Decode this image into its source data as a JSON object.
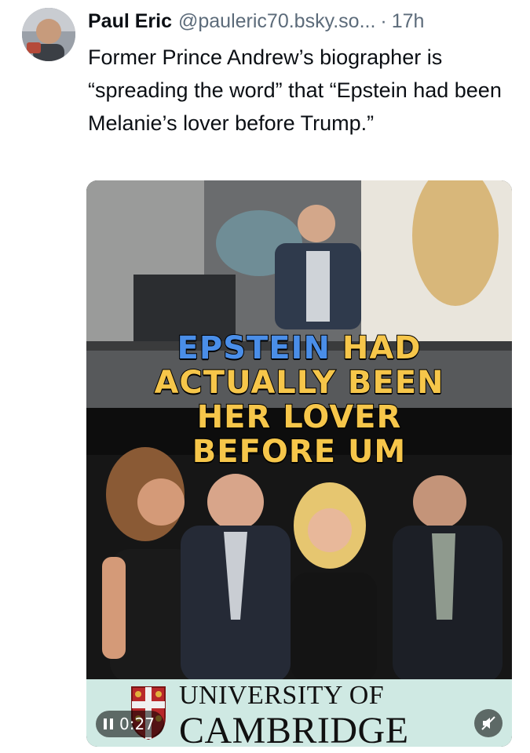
{
  "post": {
    "author_name": "Paul Eric",
    "handle": "@pauleric70.bsky.so...",
    "separator": "·",
    "time": "17h",
    "text": "Former Prince Andrew’s biographer is “spreading the word” that “Epstein had been Melanie’s lover before Trump.”"
  },
  "video": {
    "caption_word_1": "EPSTEIN",
    "caption_word_2": "HAD",
    "caption_line_2": "ACTUALLY BEEN",
    "caption_line_3": "HER LOVER",
    "caption_line_4": "BEFORE UM",
    "banner_line_1": "UNIVERSITY OF",
    "banner_line_2": "CAMBRIDGE",
    "elapsed": "0:27",
    "play_icon": "pause-icon",
    "mute_icon": "speaker-muted-icon"
  }
}
